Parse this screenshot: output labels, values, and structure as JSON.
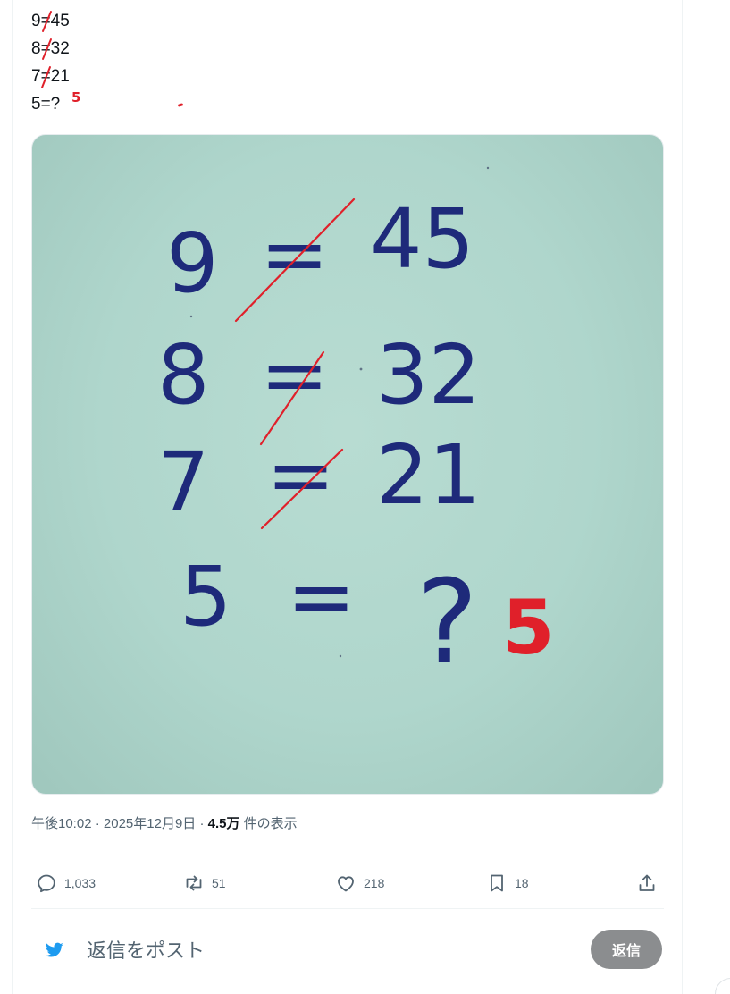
{
  "tweet": {
    "lines": [
      "9=45",
      "8=32",
      "7=21",
      "5=?"
    ],
    "handwritten_answer": "5"
  },
  "photo": {
    "rows": [
      {
        "left": "9",
        "eq": "=",
        "right": "45"
      },
      {
        "left": "8",
        "eq": "=",
        "right": "32"
      },
      {
        "left": "7",
        "eq": "=",
        "right": "21"
      },
      {
        "left": "5",
        "eq": "=",
        "right": "?"
      }
    ],
    "answer": "5",
    "ink_color": "#1e2a7a",
    "mark_color": "#e0202a"
  },
  "meta": {
    "time": "午後10:02",
    "sep1": " · ",
    "date": "2025年12月9日",
    "sep2": " · ",
    "views": "4.5万",
    "views_suffix": " 件の表示"
  },
  "actions": {
    "reply_count": "1,033",
    "repost_count": "51",
    "like_count": "218",
    "bookmark_count": "18",
    "icons": [
      "reply-icon",
      "repost-icon",
      "like-icon",
      "bookmark-icon",
      "share-icon"
    ]
  },
  "reply": {
    "placeholder": "返信をポスト",
    "button": "返信"
  },
  "colors": {
    "accent": "#1d9bf0",
    "text_secondary": "#536471",
    "disabled_button": "#8b8d8f"
  }
}
